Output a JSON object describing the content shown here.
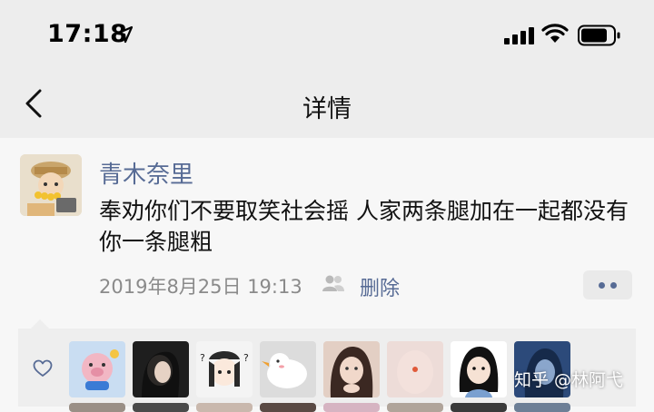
{
  "status_bar": {
    "time": "17:18"
  },
  "nav": {
    "title": "详情"
  },
  "post": {
    "username": "青木奈里",
    "text": "奉劝你们不要取笑社会摇 人家两条腿加在一起都没有你一条腿粗",
    "timestamp": "2019年8月25日 19:13",
    "delete_label": "删除"
  },
  "likes": {
    "avatars": [
      "pig-doll",
      "dark-haired-girl",
      "cartoon-girl-cap",
      "white-duck",
      "girl-hand-on-chin",
      "pink-fingertip",
      "cartoon-girl-black-hair",
      "blue-toned-girl"
    ]
  },
  "watermark": "知乎 @林阿弋",
  "colors": {
    "link": "#576b95",
    "header_bg": "#ededed",
    "page_bg": "#f7f7f7",
    "likes_bg": "#eeeeee"
  }
}
